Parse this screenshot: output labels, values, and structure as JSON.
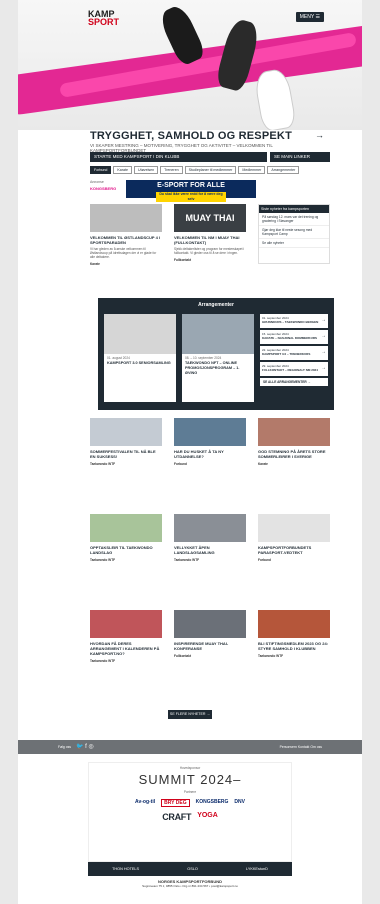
{
  "header": {
    "logo_line1": "KAMP",
    "logo_line2": "SPORT",
    "menu_label": "MENY"
  },
  "hero": {
    "title": "TRYGGHET, SAMHOLD OG RESPEKT",
    "subtitle": "VI SKAPER MESTRING – MOTIVERING, TRYGGHET OG AKTIVITET – VELKOMMEN TIL KAMPSPORTFORBUNDET"
  },
  "search": {
    "left_label": "STARTE MED KAMPSPORT I DIN KLUBB",
    "right_label": "SE MAIN LINKER"
  },
  "tabs": [
    "Forbund",
    "Karate",
    "Utøvelsen",
    "Treneren",
    "Studieplaner til medlemmer",
    "Medlemmer",
    "Arrangementer"
  ],
  "sponsor": {
    "tag": "Annonse",
    "logo": "KONGSBERG",
    "banner_title": "E-SPORT FOR ALLE",
    "banner_sub": "Du skal ikke være redd for å være deg selv"
  },
  "cards_row1": [
    {
      "title": "Velkommen til Østlandscup 4 i Sportsparaden",
      "desc": "Vi har gleden av å ønske velkommen til Østlandscup på idrettsdagen der vi er glade for alle deltakere.",
      "cat": "Karate"
    },
    {
      "title": "Velkommen til NM i Muay Thai (Fullkontakt)",
      "desc": "Sjekk deltakerlister og program for mesterskapet i fullkontakt. Vi gleder oss til å se dere i ringen.",
      "cat": "Fullkontakt",
      "img_text": "MUAY THAI"
    }
  ],
  "news_side": {
    "header": "Siste nyheter fra kampsporten",
    "items": [
      "På søndag 12. mars var det trening og gradering i Stavanger",
      "Gjør deg klar til neste sesong med Kampsport Camp",
      "Se alle nyheter"
    ]
  },
  "events": {
    "title": "Arrangementer",
    "cards": [
      {
        "date": "01. august 2024",
        "title": "KAMPSPORT 3.0 SENIORSAMLING"
      },
      {
        "date": "08. – 10. september 2024",
        "title": "TAEKWONDO NFT – ONLINE PROMOSJONSPROGRAM – 1. ØVING"
      }
    ],
    "list": [
      {
        "date": "01. september 2024",
        "title": "GRUNNKURS – TAEKWONDO BERGEN"
      },
      {
        "date": "15. september 2024",
        "title": "KARATE – NASJONAL DOMMERKURS"
      },
      {
        "date": "22. september 2024",
        "title": "KAMPSPORT 3.0 – TRENERKURS"
      },
      {
        "date": "29. september 2024",
        "title": "FULLKONTAKT – REGIONALT NM 2024"
      }
    ],
    "all_label": "SE ALLE ARRANGEMENTER"
  },
  "cards_grid": [
    {
      "title": "Sommerfestivalen til nå ble en suksess!",
      "cat": "Taekwondo WTF"
    },
    {
      "title": "Har du husket å ta ny utdannelse?",
      "cat": "Forbund"
    },
    {
      "title": "God stemning på årets store Sommerleirer i Sverige",
      "cat": "Karate"
    },
    {
      "title": "Opptaksleir til Taekwondo landslag",
      "cat": "Taekwondo WTF"
    },
    {
      "title": "Vellykket åpen landslagsamling",
      "cat": "Taekwondo WTF"
    },
    {
      "title": "Kampsportforbundets parasport-vedtekt",
      "cat": "Forbund"
    },
    {
      "title": "Hvordan få deres arrangement i kalenderen på Kampsport.no?",
      "cat": "Taekwondo WTF"
    },
    {
      "title": "Inspirerende Muay Thai-konferanse",
      "cat": "Fullkontakt"
    },
    {
      "title": "Bli stiftingsmedlem 2023 og 24: Styre samhold i klubben",
      "cat": "Taekwondo WTF"
    }
  ],
  "more_label": "SE FLERE NYHETER",
  "footer": {
    "follow_label": "Følg oss",
    "links": "Personvern   Kontakt   Om oss",
    "sponsors_small": "Hovedsponsor",
    "summit": "SUMMIT 2024–",
    "partners_small": "Partnere",
    "row1": [
      "Av-og-til",
      "BRY DEG",
      "KONGSBERG",
      "DNV"
    ],
    "craft": "CRAFT",
    "yoga": "YOGA",
    "row2": [
      "THON HOTELS",
      "OSLO",
      "LYKKEstunD"
    ],
    "org_name": "NORGES KAMPSPORTFORBUND",
    "address": "Sognsveien 75 J, 0855 Oslo • Org.nr 891 234 567 • post@kampsport.no"
  },
  "colors": {
    "brand_dark": "#1f2a33",
    "accent_pink": "#e2178b",
    "footer_grey": "#6d7175"
  }
}
